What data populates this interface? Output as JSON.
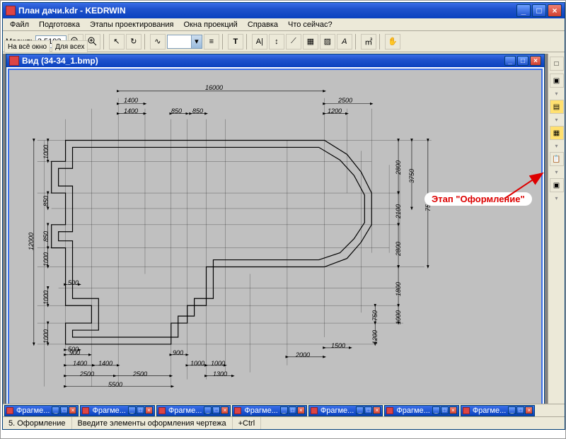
{
  "window": {
    "title": "План дачи.kdr - KEDRWIN"
  },
  "menu": {
    "file": "Файл",
    "prepare": "Подготовка",
    "stages": "Этапы проектирования",
    "projections": "Окна проекций",
    "help": "Справка",
    "whatsnew": "Что сейчас?"
  },
  "toolbar": {
    "scale_label": "Масшт:",
    "scale_value": "3.5193",
    "fit_window": "На всё окно",
    "for_all": "Для всех"
  },
  "mdi": {
    "title": "Вид (34-34_1.bmp)"
  },
  "annotation": {
    "text": "Этап \"Оформление\""
  },
  "dims": {
    "top_16000": "16000",
    "top_1400a": "1400",
    "top_2500a": "2500",
    "top_1400b": "1400",
    "top_850a": "850",
    "top_850b": "850",
    "top_1200": "1200",
    "left_12000": "12000",
    "left_1000a": "1000",
    "left_850a": "850",
    "left_850b": "850",
    "left_1000b": "1000",
    "left_1000c": "1000",
    "left_1000d": "1000",
    "right_7500": "7500",
    "right_3750": "3750",
    "right_2800a": "2800",
    "right_2100": "2100",
    "right_2800b": "2800",
    "right_1800": "1800",
    "right_1000": "1000",
    "right_750": "750",
    "right_1200": "1200",
    "bot_900a": "900",
    "bot_900b": "900",
    "bot_1400a": "1400",
    "bot_1400b": "1400",
    "bot_1000a": "1000",
    "bot_1000b": "1000",
    "bot_2000": "2000",
    "bot_1500": "1500",
    "bot_2500a": "2500",
    "bot_2500b": "2500",
    "bot_1300": "1300",
    "bot_5500": "5500",
    "in_500a": "500",
    "in_500b": "500"
  },
  "tabs": [
    "Фрагме...",
    "Фрагме...",
    "Фрагме...",
    "Фрагме...",
    "Фрагме...",
    "Фрагме...",
    "Фрагме..."
  ],
  "status": {
    "stage": "5. Оформление",
    "hint": "Введите элементы оформления чертежа",
    "key": "+Ctrl"
  }
}
